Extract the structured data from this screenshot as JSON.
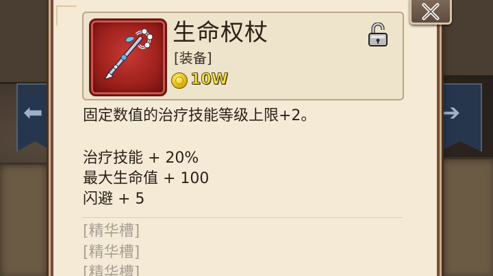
{
  "item": {
    "name": "生命权杖",
    "type": "[装备]",
    "price": "10W",
    "description": "固定数值的治疗技能等级上限+2。"
  },
  "stats": [
    "治疗技能 + 20%",
    "最大生命值 + 100",
    "闪避 + 5"
  ],
  "slots": [
    "[精华槽]",
    "[精华槽]",
    "[精华槽]"
  ],
  "icons": {
    "close": "close-icon",
    "lock": "padlock-open-icon",
    "coin": "gold-coin-icon",
    "item": "scepter-icon",
    "nav_left": "arrow-left-icon",
    "nav_right": "arrow-right-icon"
  },
  "colors": {
    "price": "#f5e14a",
    "item_frame": "#a0211d",
    "panel": "#f4ead6",
    "slot_text": "#a89f92"
  }
}
